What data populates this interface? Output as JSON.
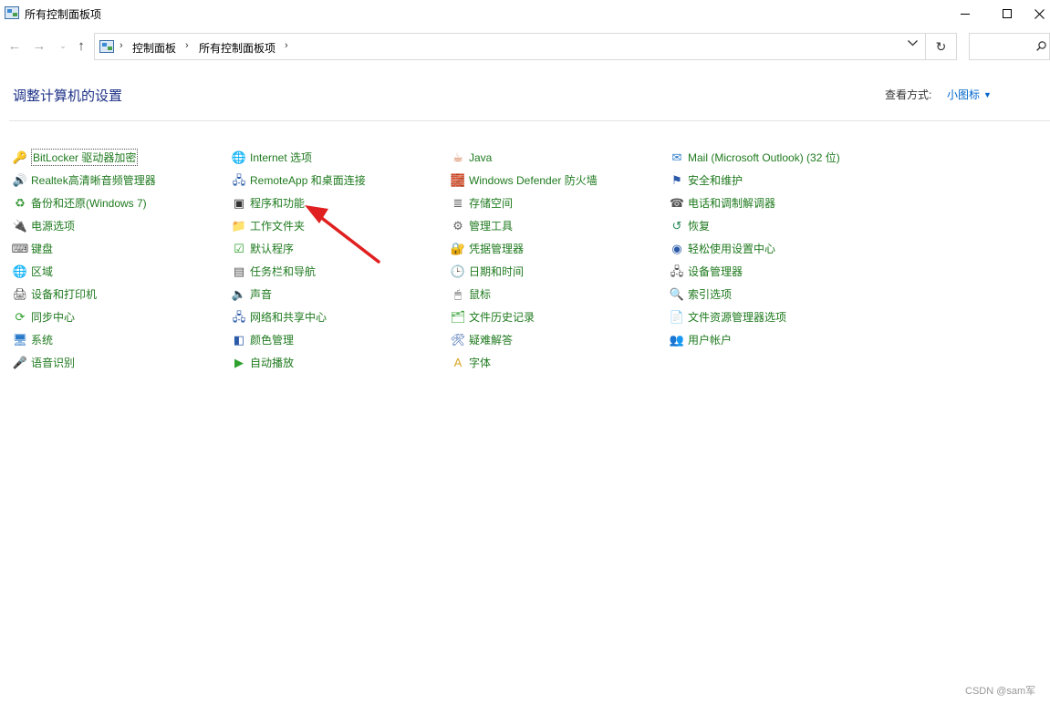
{
  "window": {
    "title": "所有控制面板项",
    "minimize_icon": "minimize-icon",
    "maximize_icon": "maximize-icon",
    "close_icon": "close-icon"
  },
  "nav": {
    "back_icon": "arrow-left-icon",
    "forward_icon": "arrow-right-icon",
    "recent_icon": "chevron-down-icon",
    "up_icon": "arrow-up-icon"
  },
  "address": {
    "breadcrumbs": [
      "控制面板",
      "所有控制面板项"
    ],
    "dropdown_icon": "chevron-down-icon",
    "refresh_icon": "refresh-icon"
  },
  "search": {
    "value": "",
    "placeholder": ""
  },
  "header": {
    "title": "调整计算机的设置",
    "view_by_label": "查看方式:",
    "view_by_value": "小图标"
  },
  "columns": [
    [
      {
        "label": "BitLocker 驱动器加密",
        "icon": "bitlocker-icon",
        "glyph": "🔑",
        "color": "#c9a227",
        "selected": true
      },
      {
        "label": "Realtek高清晰音频管理器",
        "icon": "realtek-audio-icon",
        "glyph": "🔊",
        "color": "#2b5aa8"
      },
      {
        "label": "备份和还原(Windows 7)",
        "icon": "backup-restore-icon",
        "glyph": "♻",
        "color": "#3a9a3a"
      },
      {
        "label": "电源选项",
        "icon": "power-options-icon",
        "glyph": "🔌",
        "color": "#444444"
      },
      {
        "label": "键盘",
        "icon": "keyboard-icon",
        "glyph": "⌨",
        "color": "#555555"
      },
      {
        "label": "区域",
        "icon": "region-icon",
        "glyph": "🌐",
        "color": "#2b7ac9"
      },
      {
        "label": "设备和打印机",
        "icon": "devices-printers-icon",
        "glyph": "🖨",
        "color": "#444444"
      },
      {
        "label": "同步中心",
        "icon": "sync-center-icon",
        "glyph": "⟳",
        "color": "#2fa02f"
      },
      {
        "label": "系统",
        "icon": "system-icon",
        "glyph": "🖥",
        "color": "#2b7ac9"
      },
      {
        "label": "语音识别",
        "icon": "speech-recognition-icon",
        "glyph": "🎤",
        "color": "#666666"
      }
    ],
    [
      {
        "label": "Internet 选项",
        "icon": "internet-options-icon",
        "glyph": "🌐",
        "color": "#2b8a5a"
      },
      {
        "label": "RemoteApp 和桌面连接",
        "icon": "remoteapp-icon",
        "glyph": "🖧",
        "color": "#2b5aa8"
      },
      {
        "label": "程序和功能",
        "icon": "programs-features-icon",
        "glyph": "▣",
        "color": "#333333"
      },
      {
        "label": "工作文件夹",
        "icon": "work-folders-icon",
        "glyph": "📁",
        "color": "#d9a520"
      },
      {
        "label": "默认程序",
        "icon": "default-programs-icon",
        "glyph": "☑",
        "color": "#2fa02f"
      },
      {
        "label": "任务栏和导航",
        "icon": "taskbar-navigation-icon",
        "glyph": "▤",
        "color": "#555555"
      },
      {
        "label": "声音",
        "icon": "sound-icon",
        "glyph": "🔈",
        "color": "#555555"
      },
      {
        "label": "网络和共享中心",
        "icon": "network-sharing-icon",
        "glyph": "🖧",
        "color": "#2b5aa8"
      },
      {
        "label": "颜色管理",
        "icon": "color-management-icon",
        "glyph": "◧",
        "color": "#2b5aa8"
      },
      {
        "label": "自动播放",
        "icon": "autoplay-icon",
        "glyph": "▶",
        "color": "#2fa02f"
      }
    ],
    [
      {
        "label": "Java",
        "icon": "java-icon",
        "glyph": "☕",
        "color": "#c9602a"
      },
      {
        "label": "Windows Defender 防火墙",
        "icon": "firewall-icon",
        "glyph": "🧱",
        "color": "#b5472a"
      },
      {
        "label": "存储空间",
        "icon": "storage-spaces-icon",
        "glyph": "≣",
        "color": "#666666"
      },
      {
        "label": "管理工具",
        "icon": "admin-tools-icon",
        "glyph": "⚙",
        "color": "#666666"
      },
      {
        "label": "凭据管理器",
        "icon": "credential-manager-icon",
        "glyph": "🔐",
        "color": "#c9a227"
      },
      {
        "label": "日期和时间",
        "icon": "date-time-icon",
        "glyph": "🕒",
        "color": "#2b7ac9"
      },
      {
        "label": "鼠标",
        "icon": "mouse-icon",
        "glyph": "🖱",
        "color": "#555555"
      },
      {
        "label": "文件历史记录",
        "icon": "file-history-icon",
        "glyph": "🗂",
        "color": "#2fa02f"
      },
      {
        "label": "疑难解答",
        "icon": "troubleshooting-icon",
        "glyph": "🛠",
        "color": "#2b5aa8"
      },
      {
        "label": "字体",
        "icon": "fonts-icon",
        "glyph": "A",
        "color": "#d9a520"
      }
    ],
    [
      {
        "label": "Mail (Microsoft Outlook) (32 位)",
        "icon": "mail-icon",
        "glyph": "✉",
        "color": "#2b7ac9"
      },
      {
        "label": "安全和维护",
        "icon": "security-maintenance-icon",
        "glyph": "⚑",
        "color": "#2b5aa8"
      },
      {
        "label": "电话和调制解调器",
        "icon": "phone-modem-icon",
        "glyph": "☎",
        "color": "#555555"
      },
      {
        "label": "恢复",
        "icon": "recovery-icon",
        "glyph": "↺",
        "color": "#2b8a5a"
      },
      {
        "label": "轻松使用设置中心",
        "icon": "ease-of-access-icon",
        "glyph": "◉",
        "color": "#2b5aa8"
      },
      {
        "label": "设备管理器",
        "icon": "device-manager-icon",
        "glyph": "🖧",
        "color": "#555555"
      },
      {
        "label": "索引选项",
        "icon": "indexing-options-icon",
        "glyph": "🔍",
        "color": "#555555"
      },
      {
        "label": "文件资源管理器选项",
        "icon": "file-explorer-options-icon",
        "glyph": "📄",
        "color": "#d9a520"
      },
      {
        "label": "用户帐户",
        "icon": "user-accounts-icon",
        "glyph": "👥",
        "color": "#2b7ac9"
      }
    ]
  ],
  "annotation": {
    "color": "#e02020"
  },
  "watermark": "CSDN @sam军"
}
